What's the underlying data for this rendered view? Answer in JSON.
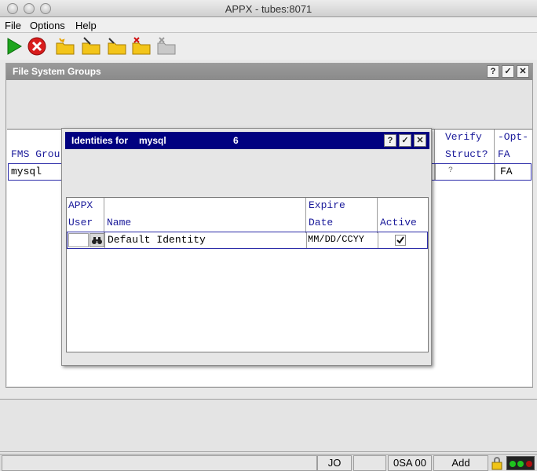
{
  "window": {
    "title": "APPX - tubes:8071"
  },
  "menu": {
    "items": [
      "File",
      "Options",
      "Help"
    ]
  },
  "toolbar": {
    "buttons": [
      {
        "icon": "run-icon"
      },
      {
        "icon": "cancel-icon"
      },
      {
        "icon": "new-folder-icon"
      },
      {
        "icon": "edit-folder-icon"
      },
      {
        "icon": "open-folder-icon"
      },
      {
        "icon": "delete-folder-icon"
      },
      {
        "icon": "disabled-folder-icon"
      }
    ]
  },
  "panel": {
    "title": "File System Groups",
    "controls": [
      "?",
      "✓",
      "✕"
    ],
    "columns": {
      "fms_group": "FMS Grou",
      "verify_line1": "Verify",
      "verify_line2": "Struct?",
      "opt_line1": "-Opt-",
      "opt_line2": "FA"
    },
    "row": {
      "fms_group": "mysql",
      "verify": "?",
      "opt": "FA"
    }
  },
  "dialog": {
    "title_label": "Identities for",
    "title_group": "mysql",
    "title_count": "6",
    "controls": [
      "?",
      "✓",
      "✕"
    ],
    "columns": {
      "appx_line1": "APPX",
      "appx_line2": "User",
      "name": "Name",
      "expire_line1": "Expire",
      "expire_line2": "Date",
      "active": "Active"
    },
    "row": {
      "appx_user": "",
      "name": "Default Identity",
      "expire_date": "MM/DD/CCYY",
      "active": true
    }
  },
  "status": {
    "cells": [
      "",
      "JO",
      "",
      "0SA 00",
      "Add"
    ],
    "colors": {
      "selection": "#2b2ba8",
      "dialog_title": "#000080",
      "header_text": "#1a1a9a"
    }
  }
}
